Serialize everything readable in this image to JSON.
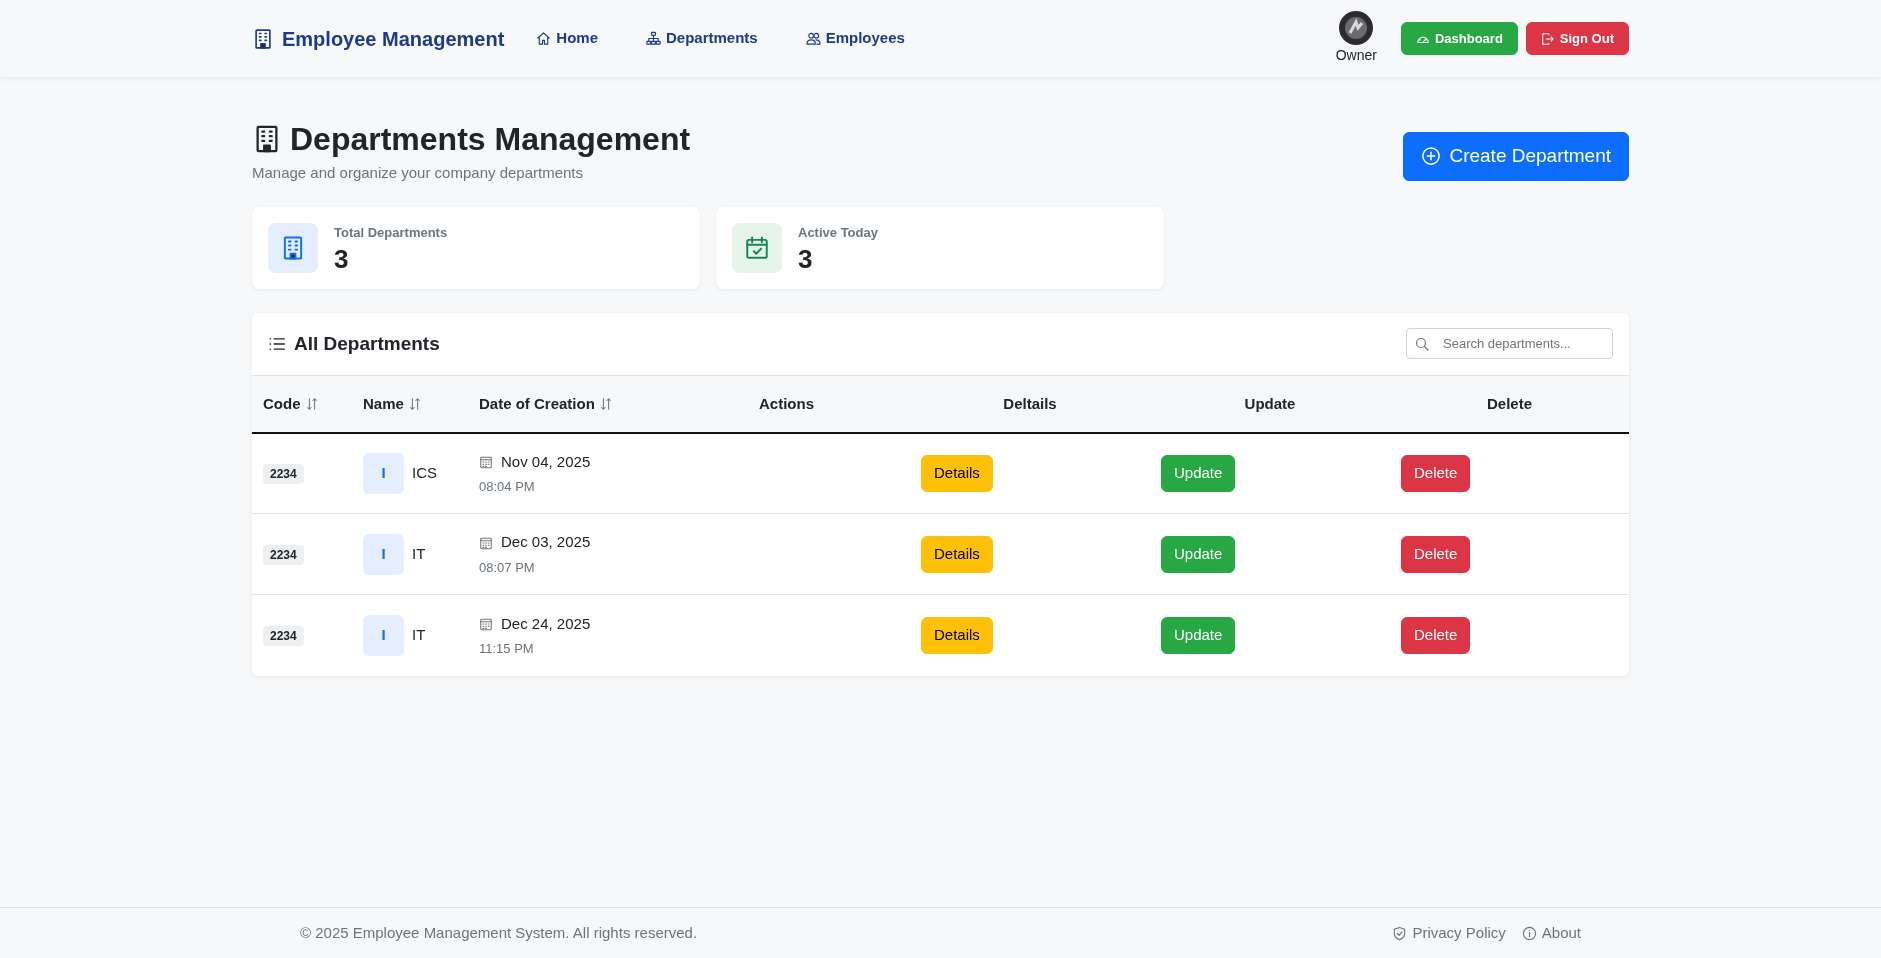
{
  "navbar": {
    "brand": "Employee Management",
    "links": [
      {
        "label": "Home",
        "kind": "home"
      },
      {
        "label": "Departments",
        "kind": "sitemap"
      },
      {
        "label": "Employees",
        "kind": "people"
      }
    ],
    "user": "Owner",
    "buttons": [
      {
        "label": "Dashboard",
        "kind": "dashboard"
      },
      {
        "label": "Sign Out",
        "kind": "signout"
      }
    ]
  },
  "header": {
    "title": "Departments Management",
    "subtitle": "Manage and organize your company departments",
    "create_button": "Create Department"
  },
  "stats": [
    {
      "label": "Total Departments",
      "value": "3",
      "kind": "building"
    },
    {
      "label": "Active Today",
      "value": "3",
      "kind": "calendar"
    }
  ],
  "table": {
    "title": "All Departments",
    "search": {
      "placeholder": "Search departments..."
    },
    "columns": [
      {
        "label": "Code",
        "sortable": true
      },
      {
        "label": "Name",
        "sortable": true
      },
      {
        "label": "Date of Creation",
        "sortable": true
      },
      {
        "label": "Actions",
        "sortable": false
      },
      {
        "label": "Deltails",
        "sortable": false
      },
      {
        "label": "Update",
        "sortable": false
      },
      {
        "label": "Delete",
        "sortable": false
      }
    ],
    "rows": [
      {
        "code": "2234",
        "initial": "I",
        "name": "ICS",
        "date": "Nov 04, 2025",
        "time": "08:04 PM",
        "details": "Details",
        "update": "Update",
        "delete": "Delete"
      },
      {
        "code": "2234",
        "initial": "I",
        "name": "IT",
        "date": "Dec 03, 2025",
        "time": "08:07 PM",
        "details": "Details",
        "update": "Update",
        "delete": "Delete"
      },
      {
        "code": "2234",
        "initial": "I",
        "name": "IT",
        "date": "Dec 24, 2025",
        "time": "11:15 PM",
        "details": "Details",
        "update": "Update",
        "delete": "Delete"
      }
    ]
  },
  "footer": {
    "copyright": "© 2025 Employee Management System. All rights reserved.",
    "links": [
      {
        "label": "Privacy Policy",
        "kind": "shield"
      },
      {
        "label": "About",
        "kind": "info"
      }
    ]
  }
}
